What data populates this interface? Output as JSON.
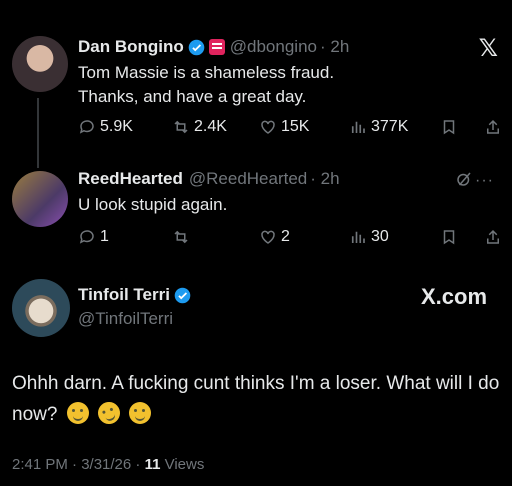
{
  "tweet1": {
    "name": "Dan Bongino",
    "handle": "@dbongino",
    "time": "· 2h",
    "line1": "Tom Massie is a shameless fraud.",
    "line2": "Thanks, and have a great day.",
    "replies": "5.9K",
    "reposts": "2.4K",
    "likes": "15K",
    "views": "377K"
  },
  "tweet2": {
    "name": "ReedHearted",
    "handle": "@ReedHearted",
    "time": "· 2h",
    "text": "U look stupid again.",
    "replies": "1",
    "likes": "2",
    "views": "30"
  },
  "tweet3": {
    "name": "Tinfoil Terri",
    "handle": "@TinfoilTerri",
    "text": "Ohhh darn. A fucking cunt thinks I'm a loser. What will I do now?",
    "timestamp": "2:41 PM · 3/31/26 ·",
    "views_count": "11",
    "views_label": "Views"
  },
  "watermark": "X.com",
  "colors": {
    "verified": "#1d9bf0",
    "background": "#000000",
    "muted": "#71767b"
  }
}
